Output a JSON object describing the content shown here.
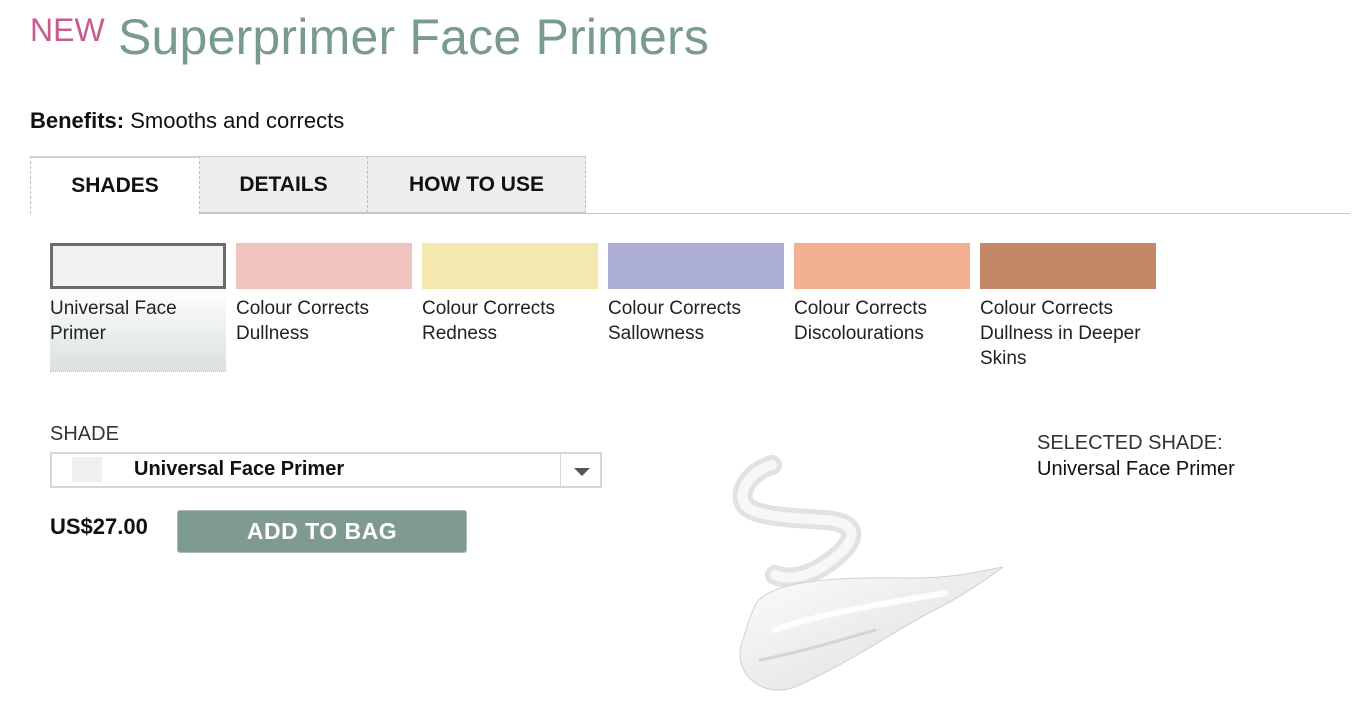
{
  "header": {
    "new_badge": "NEW",
    "title": "Superprimer Face Primers"
  },
  "benefits": {
    "label": "Benefits:",
    "text": " Smooths and corrects"
  },
  "tabs": [
    {
      "label": "SHADES",
      "active": true
    },
    {
      "label": "DETAILS",
      "active": false
    },
    {
      "label": "HOW TO USE",
      "active": false
    }
  ],
  "swatches": [
    {
      "label": "Universal Face Primer",
      "color": "#f1f1f1",
      "selected": true
    },
    {
      "label": "Colour Corrects Dullness",
      "color": "#f1c3be",
      "selected": false
    },
    {
      "label": "Colour Corrects Redness",
      "color": "#f5e8ae",
      "selected": false
    },
    {
      "label": "Colour Corrects Sallowness",
      "color": "#adaed6",
      "selected": false
    },
    {
      "label": "Colour Corrects Discolourations",
      "color": "#f2b08f",
      "selected": false
    },
    {
      "label": "Colour Corrects Dullness in Deeper Skins",
      "color": "#c48866",
      "selected": false
    }
  ],
  "shade_selector": {
    "label": "SHADE",
    "value": "Universal Face Primer",
    "chip_color": "#efefef"
  },
  "purchase": {
    "price": "US$27.00",
    "add_to_bag": "ADD TO BAG"
  },
  "selected_shade": {
    "heading": "SELECTED SHADE:",
    "value": "Universal Face Primer"
  },
  "colors": {
    "accent_green": "#7f9b8f",
    "title_green": "#7a9a8d",
    "new_pink": "#c95c8e"
  }
}
